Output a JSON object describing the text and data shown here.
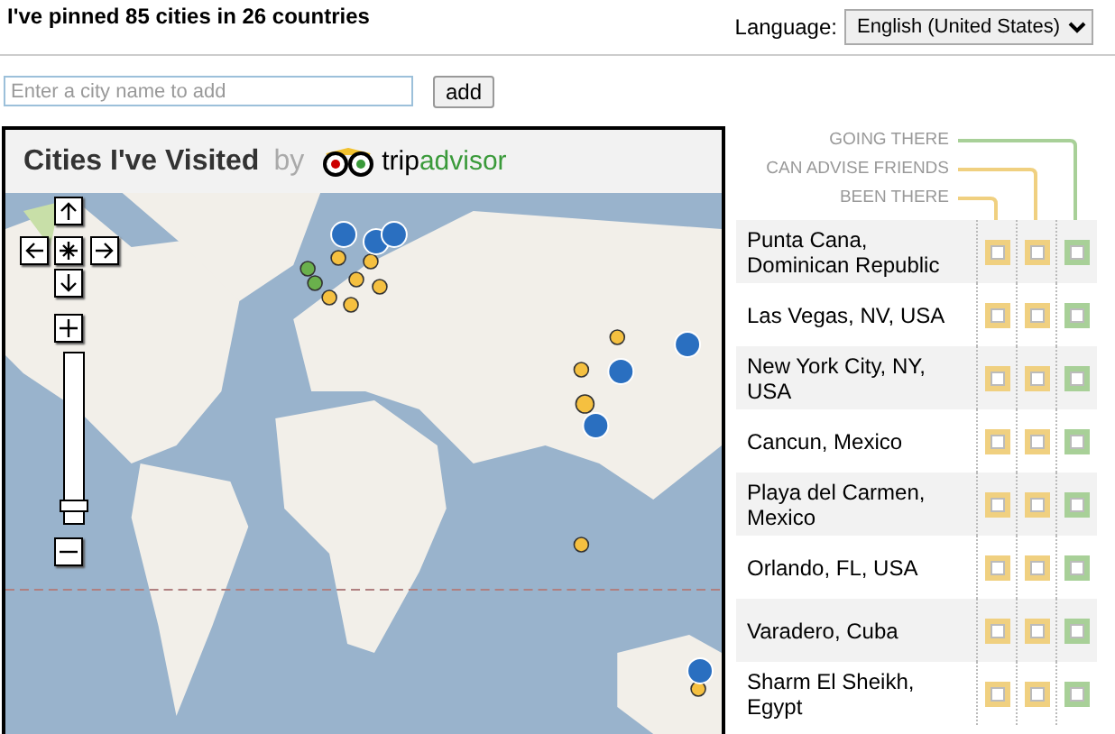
{
  "header": {
    "summary": "I've pinned 85 cities in 26 countries",
    "language_label": "Language:",
    "language_value": "English (United States)"
  },
  "add_city": {
    "placeholder": "Enter a city name to add",
    "button": "add"
  },
  "map": {
    "title": "Cities I've Visited",
    "by": "by",
    "logo_parts": [
      "trip",
      "advisor"
    ],
    "zoom": {
      "level": 0.03
    }
  },
  "legend": [
    "GOING THERE",
    "CAN ADVISE FRIENDS",
    "BEEN THERE"
  ],
  "cities": [
    {
      "name": "Punta Cana, Dominican Republic",
      "been_there": false,
      "can_advise": false,
      "going_there": false
    },
    {
      "name": "Las Vegas, NV, USA",
      "been_there": false,
      "can_advise": false,
      "going_there": false
    },
    {
      "name": "New York City, NY, USA",
      "been_there": false,
      "can_advise": false,
      "going_there": false
    },
    {
      "name": "Cancun, Mexico",
      "been_there": false,
      "can_advise": false,
      "going_there": false
    },
    {
      "name": "Playa del Carmen, Mexico",
      "been_there": false,
      "can_advise": false,
      "going_there": false
    },
    {
      "name": "Orlando, FL, USA",
      "been_there": false,
      "can_advise": false,
      "going_there": false
    },
    {
      "name": "Varadero, Cuba",
      "been_there": false,
      "can_advise": false,
      "going_there": false
    },
    {
      "name": "Sharm El Sheikh, Egypt",
      "been_there": false,
      "can_advise": false,
      "going_there": false
    }
  ]
}
